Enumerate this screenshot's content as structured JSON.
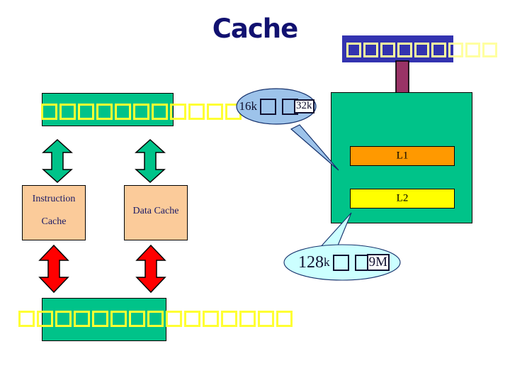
{
  "slide": {
    "title": "Cache",
    "title_color": "#111170",
    "background": "#ffffff"
  },
  "palette": {
    "green": "#00c389",
    "blue": "#3333b0",
    "peach": "#fbcb9a",
    "orange": "#ff9900",
    "yellow": "#ffff00",
    "tofu_yellow": "#ffff33",
    "maroon_arrow": "#993366",
    "red_arrow": "#ff0000",
    "green_arrow": "#00c389",
    "callout_blue": "#9dc3ea",
    "callout_cyan": "#ccffff",
    "text_navy": "#1a1a66"
  },
  "top_bar": {
    "name": "cpu-bar",
    "tofu_count": 9,
    "tofu_inside_bar": 6
  },
  "left_bar": {
    "name": "cpu-left-bar",
    "tofu_count": 11,
    "tofu_inside_bar": 7
  },
  "bottom_bar": {
    "name": "memory-bar",
    "tofu_count": 15,
    "tofu_inside_bar": 7
  },
  "caches": [
    {
      "name": "instruction-cache",
      "lines": [
        "Instruction",
        "Cache"
      ]
    },
    {
      "name": "data-cache",
      "lines": [
        "Data Cache"
      ]
    }
  ],
  "levels": [
    {
      "name": "l1",
      "label": "L1",
      "color": "#ff9900"
    },
    {
      "name": "l2",
      "label": "L2",
      "color": "#ffff00"
    }
  ],
  "callouts": [
    {
      "name": "l1-size-callout",
      "prefix": "16k",
      "overlay": "32k",
      "tofu_count": 2,
      "fill": "#9dc3ea"
    },
    {
      "name": "l2-size-callout",
      "prefix": "128",
      "prefix_sub": "k",
      "overlay": "9M",
      "tofu_count": 2,
      "fill": "#ccffff"
    }
  ],
  "arrows": [
    {
      "name": "bus-arrow-down",
      "direction": "down",
      "color": "#993366"
    },
    {
      "name": "icache-bus-arrow",
      "direction": "up-down",
      "color": "#00c389"
    },
    {
      "name": "dcache-bus-arrow",
      "direction": "up-down",
      "color": "#00c389"
    },
    {
      "name": "icache-memory-arrow",
      "direction": "up-down",
      "color": "#ff0000"
    },
    {
      "name": "dcache-memory-arrow",
      "direction": "up-down",
      "color": "#ff0000"
    }
  ]
}
